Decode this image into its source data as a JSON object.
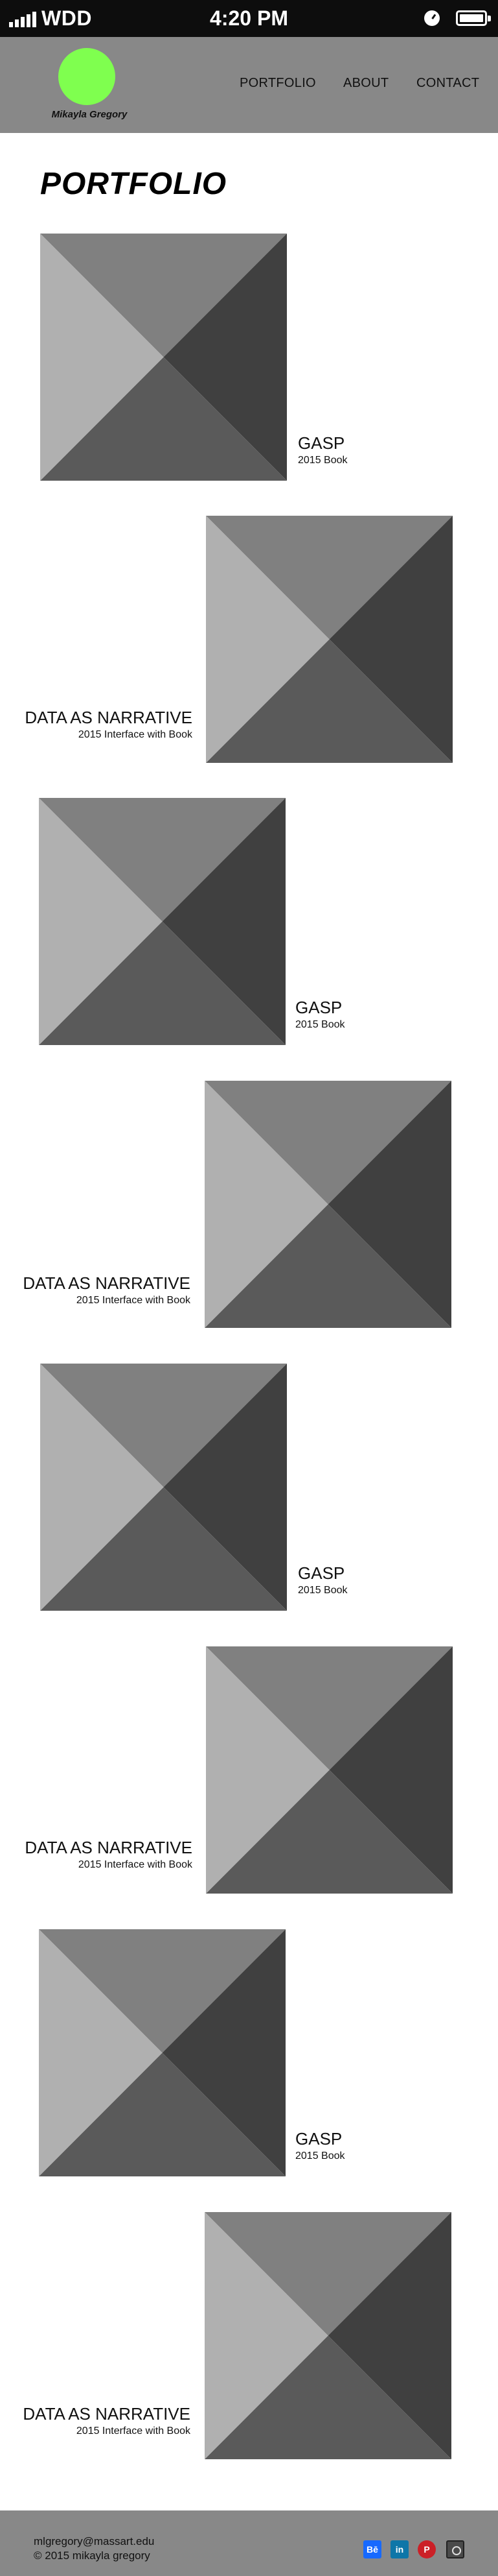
{
  "status_bar": {
    "carrier": "WDD",
    "time": "4:20 PM"
  },
  "header": {
    "logo_text": "Mikayla Gregory",
    "logo_color": "#7fff4f",
    "nav": [
      "PORTFOLIO",
      "ABOUT",
      "CONTACT"
    ]
  },
  "page_title": "PORTFOLIO",
  "items": [
    {
      "title": "GASP",
      "subtitle": "2015 Book"
    },
    {
      "title": "DATA AS NARRATIVE",
      "subtitle": "2015 Interface with Book"
    },
    {
      "title": "GASP",
      "subtitle": "2015 Book"
    },
    {
      "title": "DATA AS NARRATIVE",
      "subtitle": "2015 Interface with Book"
    },
    {
      "title": "GASP",
      "subtitle": "2015 Book"
    },
    {
      "title": "DATA AS NARRATIVE",
      "subtitle": "2015 Interface with Book"
    },
    {
      "title": "GASP",
      "subtitle": "2015 Book"
    },
    {
      "title": "DATA AS NARRATIVE",
      "subtitle": "2015 Interface with Book"
    }
  ],
  "footer": {
    "email": "mlgregory@massart.edu",
    "copyright": "© 2015 mikayla gregory",
    "social": [
      {
        "label": "Bē",
        "icon": "behance-icon"
      },
      {
        "label": "in",
        "icon": "linkedin-icon"
      },
      {
        "label": "P",
        "icon": "pinterest-icon"
      },
      {
        "label": "",
        "icon": "instagram-icon"
      }
    ]
  },
  "colors": {
    "header_bg": "#888888",
    "footer_bg": "#888888",
    "status_bar_bg": "#0d0d0d",
    "placeholder_top": "#808080",
    "placeholder_right": "#404040",
    "placeholder_bottom": "#5a5a5a",
    "placeholder_left": "#b0b0b0"
  }
}
